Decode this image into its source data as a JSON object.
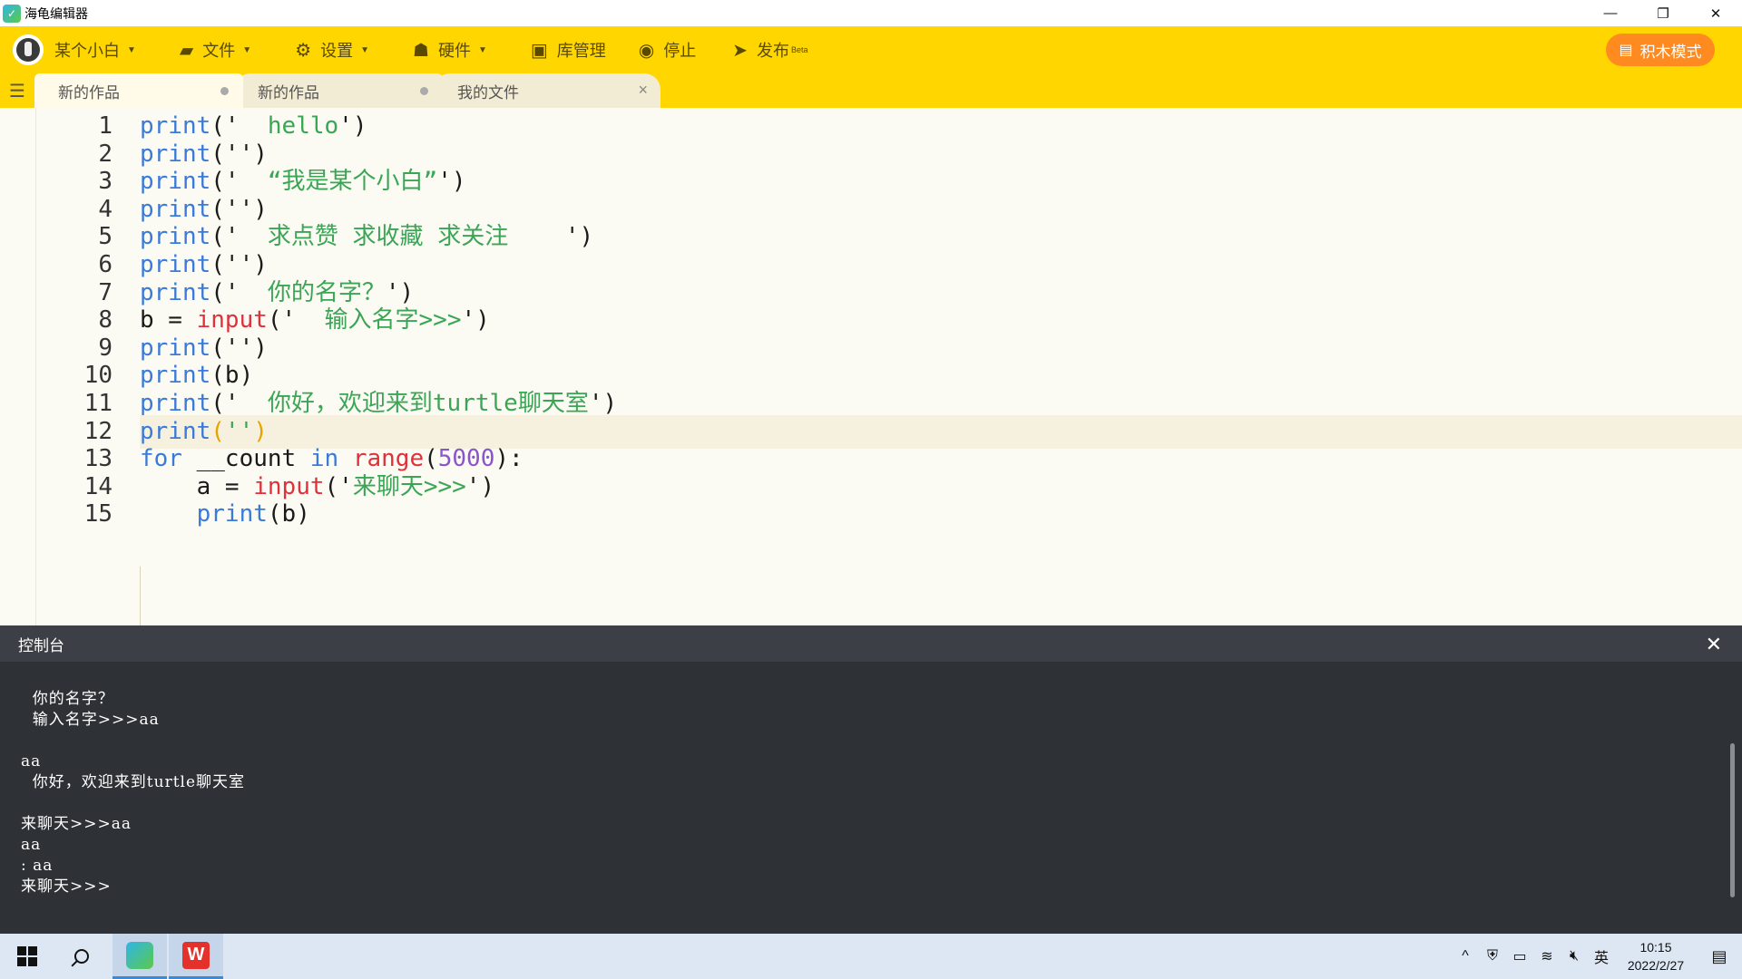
{
  "window": {
    "title": "海龟编辑器",
    "minimize": "—",
    "restore": "❐",
    "close": "✕"
  },
  "toolbar": {
    "user": "某个小白",
    "file": "文件",
    "settings": "设置",
    "hardware": "硬件",
    "library": "库管理",
    "stop": "停止",
    "publish": "发布",
    "publish_badge": "Beta",
    "block_mode": "积木模式"
  },
  "tabs": [
    {
      "label": "新的作品"
    },
    {
      "label": "新的作品"
    },
    {
      "label": "我的文件"
    }
  ],
  "editor": {
    "line_numbers": [
      "1",
      "2",
      "3",
      "4",
      "5",
      "6",
      "7",
      "8",
      "9",
      "10",
      "11",
      "12",
      "13",
      "14",
      "15"
    ],
    "lines": [
      {
        "a": "print",
        "b": "('",
        "c": "  hello",
        "d": "')"
      },
      {
        "a": "print",
        "b": "('",
        "c": "",
        "d": "')"
      },
      {
        "a": "print",
        "b": "('",
        "c": "  “我是某个小白”",
        "d": "')"
      },
      {
        "a": "print",
        "b": "('",
        "c": "",
        "d": "')"
      },
      {
        "a": "print",
        "b": "('",
        "c": "  求点赞 求收藏 求关注    ",
        "d": "')"
      },
      {
        "a": "print",
        "b": "('",
        "c": "",
        "d": "')"
      },
      {
        "a": "print",
        "b": "('",
        "c": "  你的名字？",
        "d": "')"
      },
      {
        "pre": "b = ",
        "a": "input",
        "b": "('",
        "c": "  输入名字>>>",
        "d": "')"
      },
      {
        "a": "print",
        "b": "('",
        "c": "",
        "d": "')"
      },
      {
        "a": "print",
        "b": "(b)",
        "c": "",
        "d": ""
      },
      {
        "a": "print",
        "b": "('",
        "c": "  你好，欢迎来到turtle聊天室",
        "d": "')"
      },
      {
        "a": "print",
        "b": "(",
        "c": "''",
        "d": ")"
      },
      {
        "kw1": "for",
        "var": " __count ",
        "kw2": "in",
        "fn": " range",
        "open": "(",
        "num": "5000",
        "close": "):"
      },
      {
        "pre": "    a = ",
        "a": "input",
        "b": "('",
        "c": "来聊天>>>",
        "d": "')"
      },
      {
        "pre": "    ",
        "a": "print",
        "b": "(b)",
        "c": "",
        "d": ""
      }
    ],
    "stop_button": "停止"
  },
  "console": {
    "title": "控制台",
    "close": "✕",
    "lines": [
      "  你的名字？",
      "  输入名字>>>aa",
      "",
      "aa",
      "  你好，欢迎来到turtle聊天室",
      "",
      "来聊天>>>aa",
      "aa",
      ": aa",
      "来聊天>>>"
    ]
  },
  "taskbar": {
    "tray_chevron": "^",
    "ime": "英",
    "time": "10:15",
    "date": "2022/2/27"
  }
}
